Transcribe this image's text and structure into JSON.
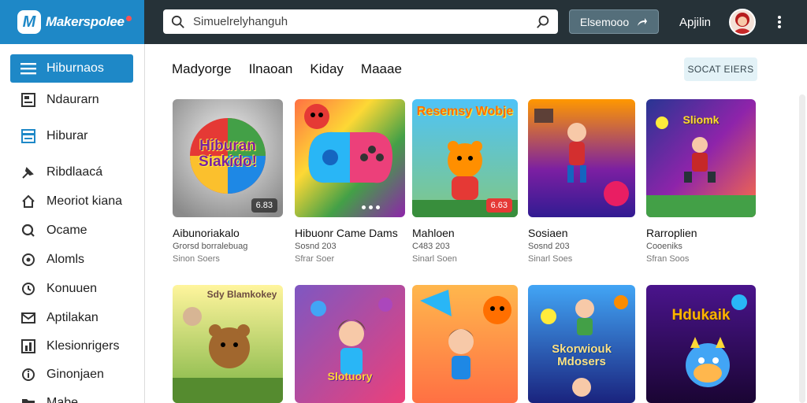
{
  "brand": {
    "logo_letter": "M",
    "name": "Makerspolee"
  },
  "search": {
    "placeholder": "Simuelrelyhanguh"
  },
  "header": {
    "button_label": "Elsemooo",
    "username": "Apjilin"
  },
  "sidebar": {
    "items": [
      {
        "label": "Hiburnaos",
        "icon": "menu-icon",
        "active": true
      },
      {
        "label": "Ndaurarn",
        "icon": "image-icon"
      },
      {
        "label": "Hiburar",
        "icon": "card-icon"
      },
      {
        "label": "Ribdlaacá",
        "icon": "pin-icon"
      },
      {
        "label": "Meoriot kiana",
        "icon": "home-icon"
      },
      {
        "label": "Ocame",
        "icon": "search-icon"
      },
      {
        "label": "Alomls",
        "icon": "gear-icon"
      },
      {
        "label": "Konuuen",
        "icon": "clock-icon"
      },
      {
        "label": "Aptilakan",
        "icon": "mail-icon"
      },
      {
        "label": "Klesionrigers",
        "icon": "chart-icon"
      },
      {
        "label": "Ginonjaen",
        "icon": "info-icon"
      },
      {
        "label": "Mabe",
        "icon": "folder-icon"
      }
    ]
  },
  "filters": {
    "tabs": [
      "Madyorge",
      "Ilnaoan",
      "Kiday",
      "Maaae"
    ],
    "sort_label": "SOCAT EIERS"
  },
  "cards": [
    {
      "title": "Aibunoriakalo",
      "subtitle": "Grorsd borralebuag",
      "meta": "Sinon Soers",
      "badge": "6.83",
      "art_text": "Hiburan Siakido!",
      "palette": "ball"
    },
    {
      "title": "Hibuonr Came Dams",
      "subtitle": "Sosnd 203",
      "meta": "Sfrar Soer",
      "badge": "",
      "art_text": "",
      "palette": "controller"
    },
    {
      "title": "Mahloen",
      "subtitle": "C483 203",
      "meta": "Sinarl Soen",
      "badge": "6.63",
      "art_text": "Resemsy Wobje",
      "palette": "bear"
    },
    {
      "title": "Sosiaen",
      "subtitle": "Sosnd 203",
      "meta": "Sinarl Soes",
      "badge": "",
      "art_text": "",
      "palette": "hero"
    },
    {
      "title": "Rarroplien",
      "subtitle": "Cooeniks",
      "meta": "Sfran Soos",
      "badge": "",
      "art_text": "Sliomk",
      "palette": "space"
    },
    {
      "title": "",
      "subtitle": "",
      "meta": "",
      "badge": "",
      "art_text": "Sdy Blamkokey",
      "palette": "jungle"
    },
    {
      "title": "",
      "subtitle": "",
      "meta": "",
      "badge": "",
      "art_text": "Slotuory",
      "palette": "kids"
    },
    {
      "title": "",
      "subtitle": "",
      "meta": "",
      "badge": "",
      "art_text": "",
      "palette": "runner"
    },
    {
      "title": "",
      "subtitle": "",
      "meta": "",
      "badge": "",
      "art_text": "Skorwiouk Mdosers",
      "palette": "monsters"
    },
    {
      "title": "",
      "subtitle": "",
      "meta": "",
      "badge": "",
      "art_text": "Hdukaik",
      "palette": "dragon"
    }
  ],
  "colors": {
    "topbar": "#263238",
    "brand": "#1e88c7",
    "accent": "#1e88c7"
  }
}
